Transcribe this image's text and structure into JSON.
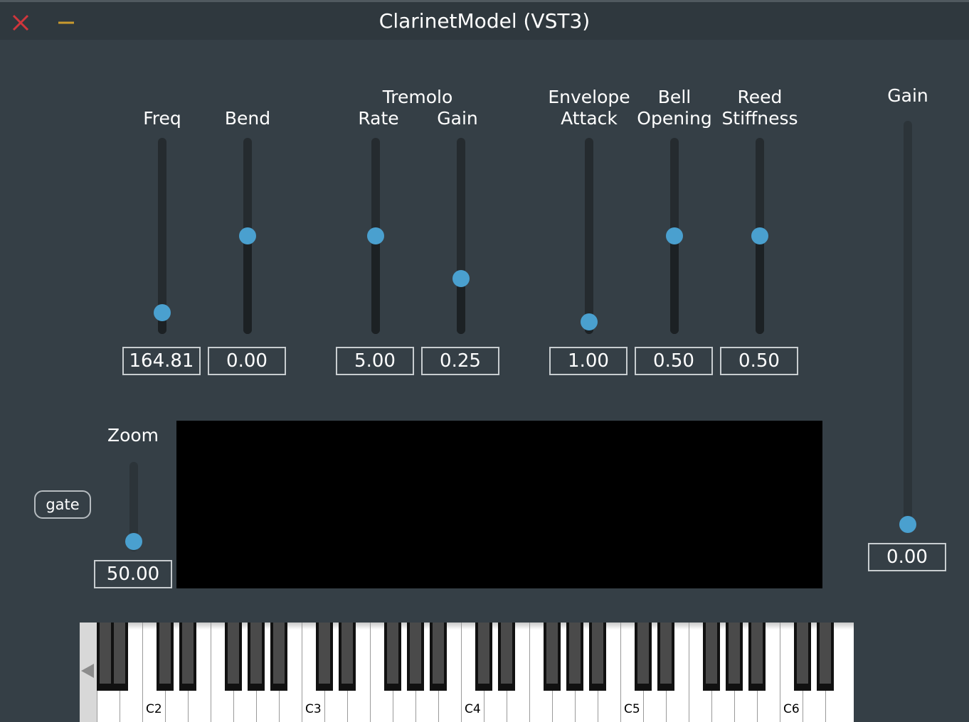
{
  "window": {
    "title": "ClarinetModel (VST3)",
    "close_icon": "close-icon",
    "minimize_icon": "minimize-icon",
    "close_color": "#d0363c",
    "minimize_color": "#c99a2e"
  },
  "controls": {
    "group_tremolo": "Tremolo",
    "freq": {
      "label": "Freq",
      "value": "164.81",
      "level": 0.07
    },
    "bend": {
      "label": "Bend",
      "value": "0.00",
      "level": 0.5
    },
    "tremolo_rate": {
      "label": "Rate",
      "value": "5.00",
      "level": 0.5
    },
    "tremolo_gain": {
      "label": "Gain",
      "value": "0.25",
      "level": 0.26
    },
    "envelope_attack": {
      "label_line1": "Envelope",
      "label_line2": "Attack",
      "value": "1.00",
      "level": 0.02
    },
    "bell_opening": {
      "label_line1": "Bell",
      "label_line2": "Opening",
      "value": "0.50",
      "level": 0.5
    },
    "reed_stiffness": {
      "label_line1": "Reed",
      "label_line2": "Stiffness",
      "value": "0.50",
      "level": 0.5
    },
    "output_gain": {
      "label": "Gain",
      "value": "0.00",
      "level": 0.0
    },
    "zoom": {
      "label": "Zoom",
      "value": "50.00",
      "level": 0.02
    }
  },
  "gate_button": {
    "label": "gate"
  },
  "keyboard": {
    "scroll_icon": "left-arrow-icon",
    "octave_labels": [
      "C2",
      "C3",
      "C4",
      "C5",
      "C6"
    ]
  },
  "accent_color": "#4aa0cf"
}
